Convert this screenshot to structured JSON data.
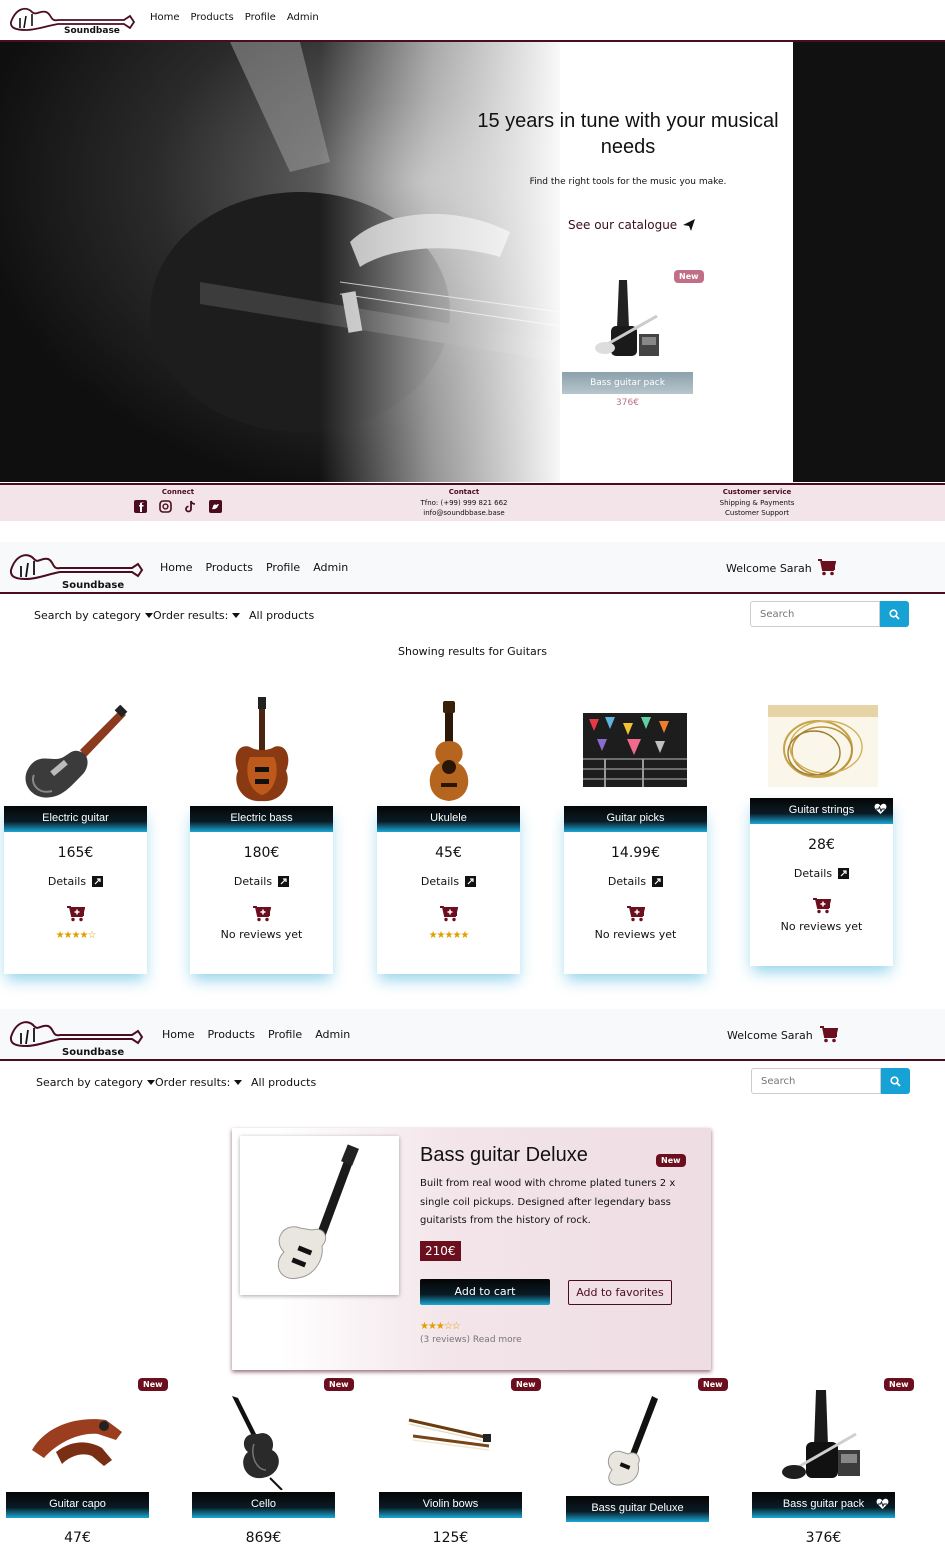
{
  "brand": {
    "name": "Soundbase"
  },
  "nav": {
    "links": [
      "Home",
      "Products",
      "Profile",
      "Admin"
    ],
    "welcome": "Welcome Sarah"
  },
  "hero": {
    "headline": "15 years in tune with your musical needs",
    "subtitle": "Find the right tools for the music you make.",
    "cta": "See our catalogue",
    "featured": {
      "badge": "New",
      "name": "Bass guitar pack",
      "price": "376€"
    }
  },
  "footer": {
    "connect": {
      "title": "Connect"
    },
    "contact": {
      "title": "Contact",
      "phone": "Tfno: (+99) 999 821 662",
      "email": "info@soundbbase.base"
    },
    "service": {
      "title": "Customer service",
      "links": [
        "Shipping & Payments",
        "Customer Support"
      ]
    }
  },
  "toolbar": {
    "category": "Search by category",
    "order": "Order results:",
    "all": "All products",
    "search_placeholder": "Search"
  },
  "results_heading": "Showing results for Guitars",
  "products": [
    {
      "name": "Electric guitar",
      "price": "165€",
      "details": "Details",
      "rating": "★★★★☆",
      "reviews": ""
    },
    {
      "name": "Electric bass",
      "price": "180€",
      "details": "Details",
      "rating": "",
      "reviews": "No reviews yet"
    },
    {
      "name": "Ukulele",
      "price": "45€",
      "details": "Details",
      "rating": "★★★★★",
      "reviews": ""
    },
    {
      "name": "Guitar picks",
      "price": "14.99€",
      "details": "Details",
      "rating": "",
      "reviews": "No reviews yet"
    },
    {
      "name": "Guitar strings",
      "price": "28€",
      "details": "Details",
      "rating": "",
      "reviews": "No reviews yet"
    }
  ],
  "featured_product": {
    "name": "Bass guitar Deluxe",
    "badge": "New",
    "description": "Built from real wood with chrome plated tuners 2 x single coil pickups. Designed after legendary bass guitarists from the history of rock.",
    "price": "210€",
    "add_to_cart": "Add to cart",
    "add_to_favorites": "Add to favorites",
    "rating": "★★★☆☆",
    "reviews": "(3 reviews) Read more"
  },
  "new_products": [
    {
      "name": "Guitar capo",
      "badge": "New",
      "price": "47€"
    },
    {
      "name": "Cello",
      "badge": "New",
      "price": "869€"
    },
    {
      "name": "Violin bows",
      "badge": "New",
      "price": "125€"
    },
    {
      "name": "Bass guitar Deluxe",
      "badge": "New",
      "price": ""
    },
    {
      "name": "Bass guitar pack",
      "badge": "New",
      "price": "376€"
    }
  ],
  "colors": {
    "brand": "#4a0d1f",
    "badge": "#6b0f1f",
    "accent": "#16a2d4",
    "star": "#e0a000"
  }
}
